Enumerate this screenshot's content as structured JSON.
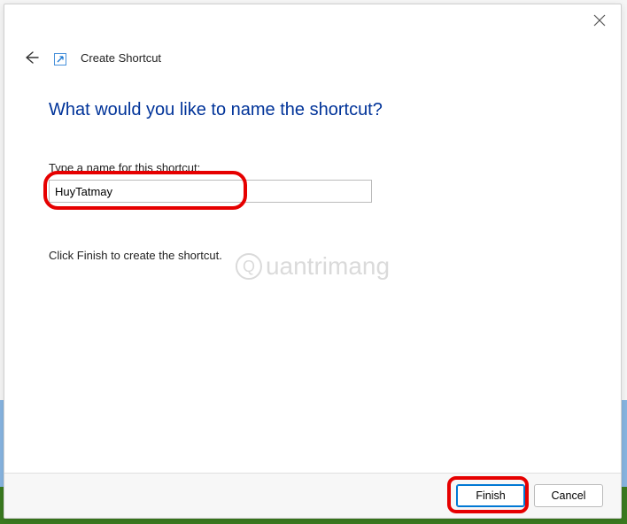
{
  "titlebar": {
    "close_label": "Close"
  },
  "header": {
    "back_label": "Back",
    "shortcut_icon_label": "shortcut",
    "wizard_title": "Create Shortcut"
  },
  "content": {
    "heading": "What would you like to name the shortcut?",
    "input_label": "Type a name for this shortcut:",
    "input_value": "HuyTatmay",
    "instruction": "Click Finish to create the shortcut."
  },
  "watermark": {
    "text": "uantrimang"
  },
  "footer": {
    "finish_label": "Finish",
    "cancel_label": "Cancel"
  }
}
